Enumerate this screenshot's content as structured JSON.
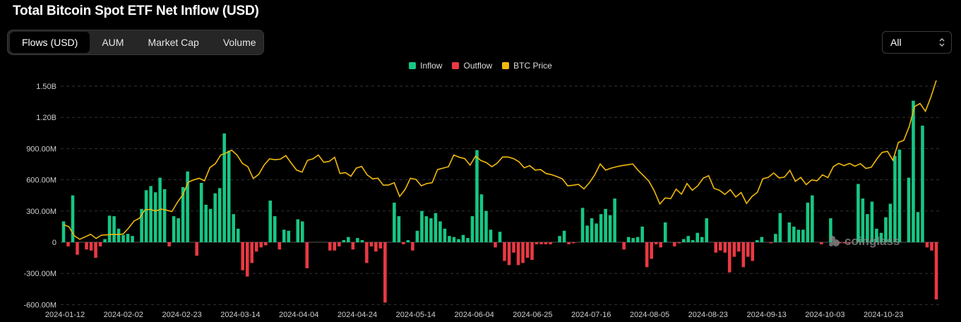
{
  "title": "Total Bitcoin Spot ETF Net Inflow (USD)",
  "tabs": [
    "Flows (USD)",
    "AUM",
    "Market Cap",
    "Volume"
  ],
  "active_tab": 0,
  "range_select": "All",
  "watermark": "coinglass",
  "chart_data": {
    "type": "bar",
    "legend": [
      {
        "name": "Inflow",
        "color": "#16c784"
      },
      {
        "name": "Outflow",
        "color": "#ea3943"
      },
      {
        "name": "BTC Price",
        "color": "#f0b90b"
      }
    ],
    "x_tick_labels": [
      "2024-01-12",
      "2024-02-02",
      "2024-02-23",
      "2024-03-14",
      "2024-04-04",
      "2024-04-24",
      "2024-05-14",
      "2024-06-04",
      "2024-06-25",
      "2024-07-16",
      "2024-08-05",
      "2024-08-23",
      "2024-09-13",
      "2024-10-03",
      "2024-10-23"
    ],
    "y_tick_labels": [
      "1.50B",
      "1.20B",
      "900.00M",
      "600.00M",
      "300.00M",
      "0",
      "-300.00M",
      "-600.00M"
    ],
    "ylim_millions": [
      -600,
      1500
    ],
    "net_flow_millions": [
      200,
      -40,
      450,
      -120,
      0,
      -70,
      -80,
      -150,
      -40,
      30,
      255,
      250,
      130,
      70,
      80,
      60,
      0,
      320,
      500,
      540,
      480,
      620,
      510,
      -40,
      250,
      230,
      530,
      680,
      0,
      -130,
      570,
      360,
      320,
      470,
      520,
      1045,
      880,
      270,
      130,
      -270,
      -330,
      -200,
      -90,
      -50,
      -30,
      400,
      250,
      -70,
      120,
      110,
      0,
      220,
      200,
      -250,
      0,
      0,
      0,
      0,
      -80,
      -80,
      -40,
      20,
      50,
      -70,
      40,
      20,
      -200,
      -40,
      -90,
      -60,
      -580,
      0,
      380,
      250,
      -20,
      20,
      -80,
      110,
      300,
      250,
      230,
      280,
      200,
      130,
      60,
      50,
      30,
      70,
      40,
      250,
      885,
      460,
      300,
      120,
      -50,
      100,
      -180,
      -220,
      -100,
      -220,
      -200,
      -150,
      -170,
      -20,
      -20,
      -20,
      -20,
      0,
      60,
      110,
      -20,
      -10,
      0,
      330,
      160,
      230,
      180,
      270,
      320,
      260,
      420,
      0,
      -70,
      50,
      40,
      50,
      150,
      -240,
      -160,
      -20,
      -50,
      190,
      0,
      -40,
      -10,
      30,
      60,
      20,
      90,
      50,
      230,
      0,
      -100,
      -80,
      -100,
      -290,
      -140,
      -90,
      -240,
      -140,
      -180,
      20,
      50,
      0,
      -10,
      80,
      280,
      0,
      190,
      150,
      120,
      120,
      380,
      450,
      0,
      -20,
      0,
      230,
      0,
      -10,
      -10,
      -10,
      0,
      560,
      420,
      270,
      390,
      130,
      90,
      240,
      370,
      830,
      890,
      0,
      620,
      1360,
      290,
      1120,
      -50,
      -80,
      -550
    ],
    "btc_price_usd": [
      46500,
      45800,
      42500,
      41300,
      42200,
      43100,
      41600,
      42800,
      42900,
      43100,
      43000,
      43200,
      45300,
      47800,
      48800,
      51800,
      52000,
      51400,
      52100,
      51700,
      51200,
      54500,
      57200,
      61700,
      62500,
      63100,
      62200,
      66900,
      68300,
      71400,
      72100,
      73100,
      71400,
      68400,
      67200,
      63000,
      64500,
      67800,
      70000,
      69700,
      69900,
      71200,
      68500,
      66000,
      65300,
      69500,
      70000,
      71400,
      68800,
      69100,
      70600,
      64800,
      65100,
      63800,
      66700,
      67300,
      64300,
      62900,
      63100,
      60600,
      60700,
      61500,
      56600,
      59100,
      63100,
      62700,
      60400,
      61200,
      61500,
      66200,
      66700,
      67200,
      71400,
      70600,
      70100,
      67800,
      71000,
      69400,
      68700,
      67200,
      68500,
      70700,
      70700,
      70100,
      69000,
      66800,
      67600,
      66000,
      66200,
      64800,
      64400,
      63700,
      62900,
      60400,
      60600,
      60900,
      59300,
      61500,
      64300,
      68200,
      66000,
      66700,
      67200,
      67600,
      67900,
      68200,
      65900,
      64000,
      62000,
      58500,
      53900,
      56100,
      55800,
      59200,
      57400,
      61200,
      58800,
      60400,
      63100,
      64000,
      59500,
      58800,
      57300,
      59000,
      56400,
      58000,
      54100,
      56600,
      58100,
      62900,
      63400,
      65000,
      63200,
      63500,
      65900,
      62000,
      63400,
      60800,
      62500,
      62200,
      64300,
      63300,
      67200,
      68400,
      67600,
      68400,
      67400,
      68300,
      66600,
      67000,
      69900,
      72300,
      72700,
      69500,
      75900,
      76600,
      81500,
      88700,
      89800,
      87000,
      92000,
      98000
    ]
  }
}
